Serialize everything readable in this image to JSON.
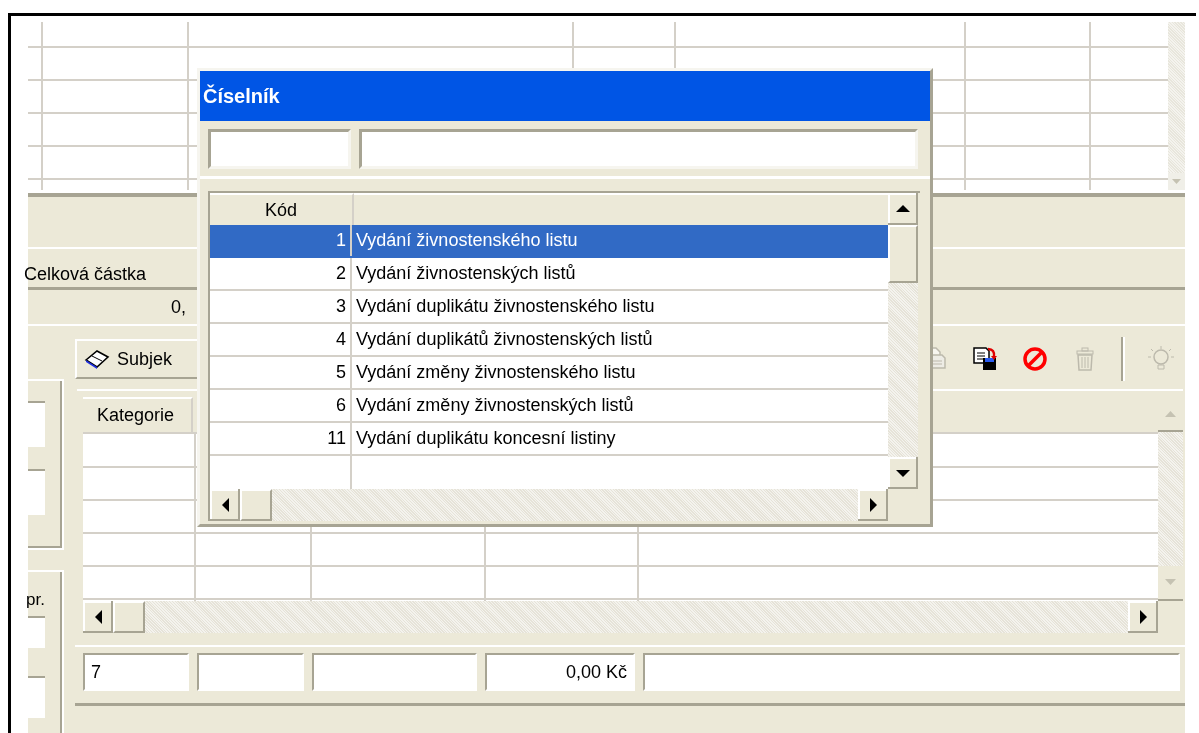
{
  "background": {
    "summary": {
      "label": "Celková částka",
      "value": "0,"
    },
    "toolbar": {
      "button": "Subjek",
      "icons": [
        {
          "kind": "copy",
          "disabled": true
        },
        {
          "kind": "save",
          "disabled": false
        },
        {
          "kind": "cancel",
          "disabled": false
        },
        {
          "kind": "delete",
          "disabled": true
        },
        {
          "kind": "separator"
        },
        {
          "kind": "hint",
          "disabled": true
        }
      ]
    },
    "side_label": "pr.",
    "table": {
      "columns": [
        "Kategorie"
      ]
    },
    "footer_fields": [
      {
        "kind": "text",
        "value": "7"
      },
      {
        "kind": "text"
      },
      {
        "kind": "text"
      },
      {
        "kind": "amount",
        "value": "0,00 Kč"
      },
      {
        "kind": "text"
      }
    ]
  },
  "dialog": {
    "title": "Číselník",
    "filters": [
      {
        "kind": "code"
      },
      {
        "kind": "name"
      }
    ],
    "table": {
      "columns": [
        "Kód"
      ],
      "rows": [
        {
          "code": "1",
          "name": "Vydání živnostenského listu",
          "selected": true
        },
        {
          "code": "2",
          "name": "Vydání živnostenských listů",
          "selected": false
        },
        {
          "code": "3",
          "name": "Vydání duplikátu živnostenského listu",
          "selected": false
        },
        {
          "code": "4",
          "name": "Vydání duplikátů živnostenských listů",
          "selected": false
        },
        {
          "code": "5",
          "name": "Vydání změny živnostenského listu",
          "selected": false
        },
        {
          "code": "6",
          "name": "Vydání změny živnostenských listů",
          "selected": false
        },
        {
          "code": "11",
          "name": "Vydání duplikátu koncesní listiny",
          "selected": false
        }
      ]
    }
  }
}
